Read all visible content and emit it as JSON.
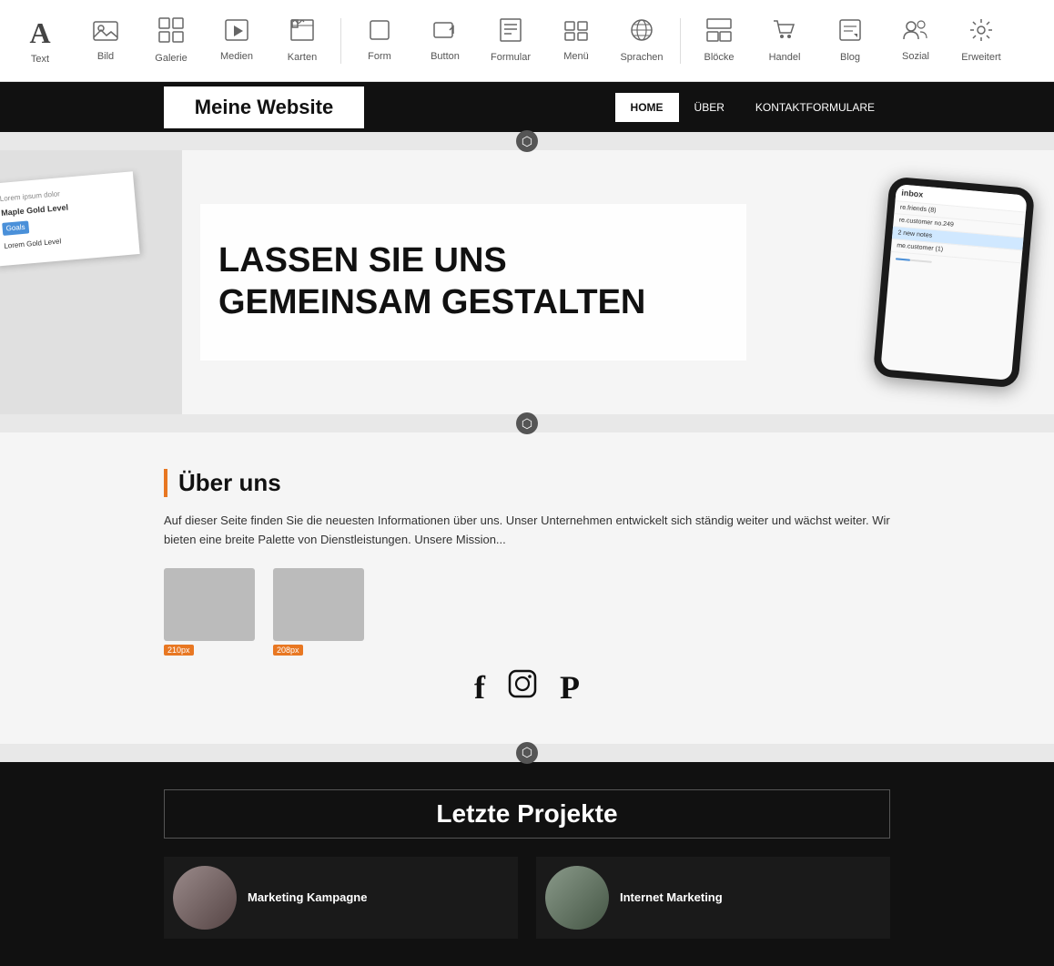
{
  "toolbar": {
    "items": [
      {
        "label": "Text",
        "icon": "A",
        "name": "text"
      },
      {
        "label": "Bild",
        "icon": "🖼",
        "name": "bild"
      },
      {
        "label": "Galerie",
        "icon": "⊞",
        "name": "galerie"
      },
      {
        "label": "Medien",
        "icon": "▶",
        "name": "medien"
      },
      {
        "label": "Karten",
        "icon": "📖",
        "name": "karten"
      },
      {
        "label": "Form",
        "icon": "□",
        "name": "form"
      },
      {
        "label": "Button",
        "icon": "↗",
        "name": "button"
      },
      {
        "label": "Formular",
        "icon": "≡",
        "name": "formular"
      },
      {
        "label": "Menü",
        "icon": "⠿",
        "name": "menue"
      },
      {
        "label": "Sprachen",
        "icon": "🌐",
        "name": "sprachen"
      },
      {
        "label": "Blöcke",
        "icon": "▦",
        "name": "bloecke"
      },
      {
        "label": "Handel",
        "icon": "🛒",
        "name": "handel"
      },
      {
        "label": "Blog",
        "icon": "✎",
        "name": "blog"
      },
      {
        "label": "Sozial",
        "icon": "👥",
        "name": "sozial"
      },
      {
        "label": "Erweitert",
        "icon": "⚙",
        "name": "erweitert"
      }
    ]
  },
  "site": {
    "logo": "Meine Website",
    "nav": [
      {
        "label": "HOME",
        "active": true
      },
      {
        "label": "ÜBER",
        "active": false
      },
      {
        "label": "KONTAKTFORMULARE",
        "active": false
      }
    ]
  },
  "hero": {
    "title": "LASSEN SIE UNS GEMEINSAM GESTALTEN"
  },
  "phone": {
    "header": "inbox",
    "rows": [
      {
        "text": "me.customer (1)",
        "selected": false
      },
      {
        "text": "re.customer no.249",
        "selected": true
      },
      {
        "text": "2 new notes",
        "selected": false
      },
      {
        "text": "re.friends (8)",
        "selected": false
      }
    ]
  },
  "about": {
    "title": "Über uns",
    "text": "Auf dieser Seite finden Sie die neuesten Informationen über uns. Unser Unternehmen entwickelt sich ständig weiter und wächst weiter. Wir bieten eine breite Palette von Dienstleistungen. Unsere Mission...",
    "social": [
      {
        "name": "facebook",
        "icon": "f"
      },
      {
        "name": "instagram",
        "icon": "◉"
      },
      {
        "name": "pinterest",
        "icon": "𝖕"
      }
    ],
    "image1_size": "210px",
    "image2_size": "208px"
  },
  "projects": {
    "title": "Letzte Projekte",
    "items": [
      {
        "name": "Marketing Kampagne",
        "thumb_color": "#666"
      },
      {
        "name": "Internet Marketing",
        "thumb_color": "#555"
      }
    ]
  }
}
